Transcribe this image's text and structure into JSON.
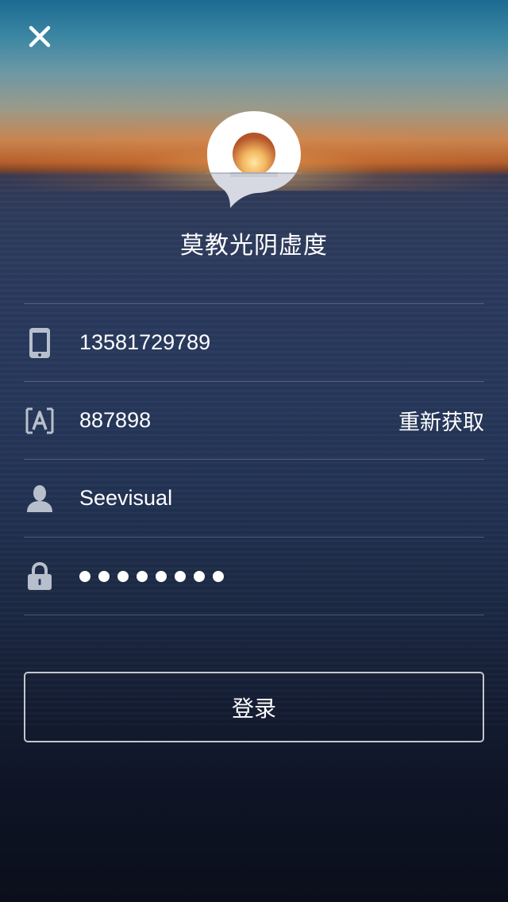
{
  "app": {
    "name": "莫教光阴虚度"
  },
  "icons": {
    "close": "close-icon",
    "logo": "sunset-chat-logo",
    "phone": "phone-icon",
    "verification_code": "verification-code-icon",
    "user": "user-icon",
    "lock": "lock-icon"
  },
  "form": {
    "phone_value": "13581729789",
    "code_value": "887898",
    "resend_label": "重新获取",
    "username_value": "Seevisual",
    "password_masked_count": 8
  },
  "actions": {
    "login_label": "登录"
  },
  "colors": {
    "text": "#ffffff",
    "icon": "#b8bfcc",
    "divider": "rgba(255,255,255,0.22)"
  }
}
